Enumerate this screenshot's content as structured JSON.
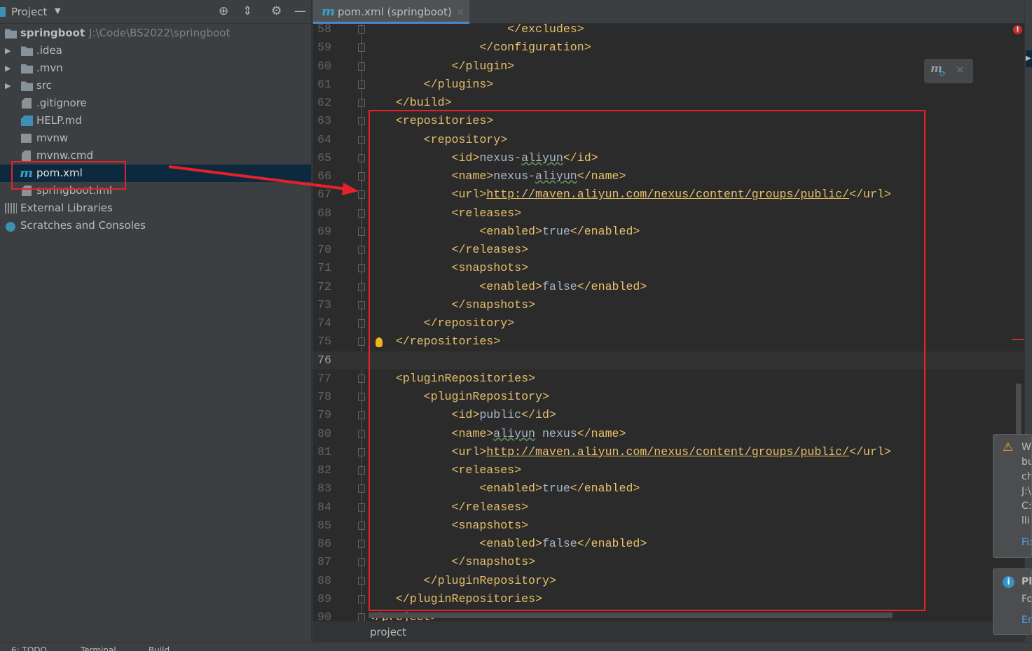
{
  "project_panel": {
    "title": "Project",
    "root": {
      "name": "springboot",
      "path": "J:\\Code\\BS2022\\springboot"
    },
    "items": [
      {
        "label": ".idea",
        "type": "folder",
        "expandable": true
      },
      {
        "label": ".mvn",
        "type": "folder",
        "expandable": true
      },
      {
        "label": "src",
        "type": "folder",
        "expandable": true
      },
      {
        "label": ".gitignore",
        "type": "file"
      },
      {
        "label": "HELP.md",
        "type": "markdown"
      },
      {
        "label": "mvnw",
        "type": "script"
      },
      {
        "label": "mvnw.cmd",
        "type": "file"
      },
      {
        "label": "pom.xml",
        "type": "maven",
        "selected": true
      },
      {
        "label": "springboot.iml",
        "type": "file"
      }
    ],
    "external_libraries": "External Libraries",
    "scratches": "Scratches and Consoles"
  },
  "editor": {
    "tab": {
      "logo": "m",
      "label": "pom.xml (springboot)",
      "close": "×"
    },
    "current_line": 76,
    "lines": [
      {
        "n": "58",
        "i": 20,
        "s": [
          [
            "tag",
            "</excludes>"
          ]
        ]
      },
      {
        "n": "59",
        "i": 16,
        "s": [
          [
            "tag",
            "</configuration>"
          ]
        ]
      },
      {
        "n": "60",
        "i": 12,
        "s": [
          [
            "tag",
            "</plugin>"
          ]
        ]
      },
      {
        "n": "61",
        "i": 8,
        "s": [
          [
            "tag",
            "</plugins>"
          ]
        ]
      },
      {
        "n": "62",
        "i": 4,
        "s": [
          [
            "tag",
            "</build>"
          ]
        ]
      },
      {
        "n": "63",
        "i": 4,
        "s": [
          [
            "tag",
            "<repositories>"
          ]
        ]
      },
      {
        "n": "64",
        "i": 8,
        "s": [
          [
            "tag",
            "<repository>"
          ]
        ]
      },
      {
        "n": "65",
        "i": 12,
        "s": [
          [
            "tag",
            "<id>"
          ],
          [
            "plain",
            "nexus-"
          ],
          [
            "wavy",
            "aliyun"
          ],
          [
            "tag",
            "</id>"
          ]
        ]
      },
      {
        "n": "66",
        "i": 12,
        "s": [
          [
            "tag",
            "<name>"
          ],
          [
            "plain",
            "nexus-"
          ],
          [
            "wavy",
            "aliyun"
          ],
          [
            "tag",
            "</name>"
          ]
        ]
      },
      {
        "n": "67",
        "i": 12,
        "s": [
          [
            "tag",
            "<url>"
          ],
          [
            "link",
            "http://maven.aliyun.com/nexus/content/groups/public/"
          ],
          [
            "tag",
            "</url>"
          ]
        ]
      },
      {
        "n": "68",
        "i": 12,
        "s": [
          [
            "tag",
            "<releases>"
          ]
        ]
      },
      {
        "n": "69",
        "i": 16,
        "s": [
          [
            "tag",
            "<enabled>"
          ],
          [
            "plain",
            "true"
          ],
          [
            "tag",
            "</enabled>"
          ]
        ]
      },
      {
        "n": "70",
        "i": 12,
        "s": [
          [
            "tag",
            "</releases>"
          ]
        ]
      },
      {
        "n": "71",
        "i": 12,
        "s": [
          [
            "tag",
            "<snapshots>"
          ]
        ]
      },
      {
        "n": "72",
        "i": 16,
        "s": [
          [
            "tag",
            "<enabled>"
          ],
          [
            "plain",
            "false"
          ],
          [
            "tag",
            "</enabled>"
          ]
        ]
      },
      {
        "n": "73",
        "i": 12,
        "s": [
          [
            "tag",
            "</snapshots>"
          ]
        ]
      },
      {
        "n": "74",
        "i": 8,
        "s": [
          [
            "tag",
            "</repository>"
          ]
        ]
      },
      {
        "n": "75",
        "i": 4,
        "s": [
          [
            "tag",
            "</repositories>"
          ]
        ]
      },
      {
        "n": "76",
        "i": 0,
        "s": []
      },
      {
        "n": "77",
        "i": 4,
        "s": [
          [
            "tag",
            "<pluginRepositories>"
          ]
        ]
      },
      {
        "n": "78",
        "i": 8,
        "s": [
          [
            "tag",
            "<pluginRepository>"
          ]
        ]
      },
      {
        "n": "79",
        "i": 12,
        "s": [
          [
            "tag",
            "<id>"
          ],
          [
            "plain",
            "public"
          ],
          [
            "tag",
            "</id>"
          ]
        ]
      },
      {
        "n": "80",
        "i": 12,
        "s": [
          [
            "tag",
            "<name>"
          ],
          [
            "wavy",
            "aliyun"
          ],
          [
            "plain",
            " nexus"
          ],
          [
            "tag",
            "</name>"
          ]
        ]
      },
      {
        "n": "81",
        "i": 12,
        "s": [
          [
            "tag",
            "<url>"
          ],
          [
            "link",
            "http://maven.aliyun.com/nexus/content/groups/public/"
          ],
          [
            "tag",
            "</url>"
          ]
        ]
      },
      {
        "n": "82",
        "i": 12,
        "s": [
          [
            "tag",
            "<releases>"
          ]
        ]
      },
      {
        "n": "83",
        "i": 16,
        "s": [
          [
            "tag",
            "<enabled>"
          ],
          [
            "plain",
            "true"
          ],
          [
            "tag",
            "</enabled>"
          ]
        ]
      },
      {
        "n": "84",
        "i": 12,
        "s": [
          [
            "tag",
            "</releases>"
          ]
        ]
      },
      {
        "n": "85",
        "i": 12,
        "s": [
          [
            "tag",
            "<snapshots>"
          ]
        ]
      },
      {
        "n": "86",
        "i": 16,
        "s": [
          [
            "tag",
            "<enabled>"
          ],
          [
            "plain",
            "false"
          ],
          [
            "tag",
            "</enabled>"
          ]
        ]
      },
      {
        "n": "87",
        "i": 12,
        "s": [
          [
            "tag",
            "</snapshots>"
          ]
        ]
      },
      {
        "n": "88",
        "i": 8,
        "s": [
          [
            "tag",
            "</pluginRepository>"
          ]
        ]
      },
      {
        "n": "89",
        "i": 4,
        "s": [
          [
            "tag",
            "</pluginRepositories>"
          ]
        ]
      },
      {
        "n": "90",
        "i": 0,
        "s": [
          [
            "tag",
            "</project>"
          ]
        ]
      }
    ],
    "breadcrumb": "project"
  },
  "notifications": [
    {
      "type": "warning",
      "lines": [
        "W",
        "bu",
        "ch",
        "J:\\",
        "C:\\",
        "lli"
      ],
      "link": "Fix"
    },
    {
      "type": "info",
      "title": "Pl",
      "lines": [
        "Fo"
      ],
      "link": "En"
    }
  ],
  "bottom_bar": [
    "6: TODO",
    "Terminal",
    "Build"
  ],
  "colors": {
    "tag": "#e8bf6a",
    "text": "#a9b7c6",
    "annotation": "#e6212a",
    "selection": "#0d293e",
    "accent": "#4a88c7"
  }
}
